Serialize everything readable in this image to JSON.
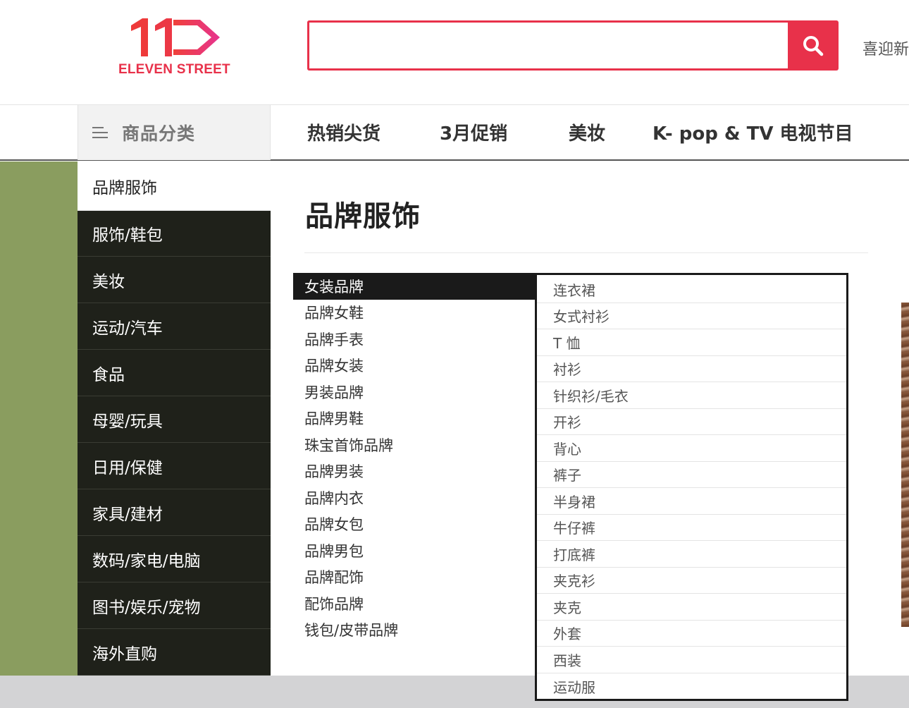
{
  "logo": {
    "text": "ELEVEN STREET",
    "mark": "11-arrow-logo",
    "color": "#e8314a"
  },
  "search": {
    "value": "",
    "placeholder": "",
    "icon": "search-icon"
  },
  "header": {
    "welcome": "喜迎新"
  },
  "nav": {
    "categories_label": "商品分类",
    "items": [
      "热销尖货",
      "3月促销",
      "美妆",
      "K- pop & TV 电视节目"
    ]
  },
  "categories": [
    "品牌服饰",
    "服饰/鞋包",
    "美妆",
    "运动/汽车",
    "食品",
    "母婴/玩具",
    "日用/保健",
    "家具/建材",
    "数码/家电/电脑",
    "图书/娱乐/宠物",
    "海外直购"
  ],
  "flyout": {
    "title": "品牌服饰",
    "subcategories": [
      "女装品牌",
      "品牌女鞋",
      "品牌手表",
      "品牌女装",
      "男装品牌",
      "品牌男鞋",
      "珠宝首饰品牌",
      "品牌男装",
      "品牌内衣",
      "品牌女包",
      "品牌男包",
      "品牌配饰",
      "配饰品牌",
      "钱包/皮带品牌"
    ],
    "active_subcategory": "女装品牌",
    "items": [
      "连衣裙",
      "女式衬衫",
      "T 恤",
      "衬衫",
      "针织衫/毛衣",
      "开衫",
      "背心",
      "裤子",
      "半身裙",
      "牛仔裤",
      "打底裤",
      "夹克衫",
      "夹克",
      "外套",
      "西装",
      "运动服"
    ]
  },
  "colors": {
    "accent": "#e8314a",
    "menu_dark": "#1f211a",
    "banner_green": "#8a9d5f"
  }
}
